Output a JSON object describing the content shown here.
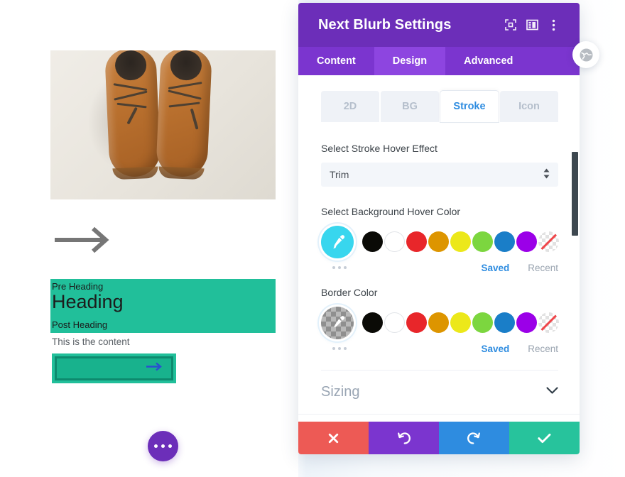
{
  "preview": {
    "photo_alt": "brown-leather-shoes-photo",
    "arrow_icon": "long-arrow-right-icon",
    "pre_heading": "Pre Heading",
    "heading": "Heading",
    "post_heading": "Post Heading",
    "content": "This is the content",
    "cta_arrow_icon": "arrow-right-icon",
    "band_color": "#21bf9a",
    "cta_border_color": "#0d8a6e",
    "cta_fill_color": "#18b28d",
    "cta_arrow_color": "#2a4fd0",
    "fab_icon": "ellipsis-icon",
    "fab_color": "#6c2eb9"
  },
  "panel": {
    "title": "Next Blurb Settings",
    "accent_color": "#6c2eb9",
    "header_icons": [
      {
        "name": "focus-target-icon"
      },
      {
        "name": "layout-panel-icon"
      },
      {
        "name": "more-vertical-icon"
      }
    ],
    "tabs": [
      {
        "label": "Content",
        "active": false
      },
      {
        "label": "Design",
        "active": true
      },
      {
        "label": "Advanced",
        "active": false
      }
    ],
    "segment": [
      {
        "label": "2D",
        "active": false
      },
      {
        "label": "BG",
        "active": false
      },
      {
        "label": "Stroke",
        "active": true
      },
      {
        "label": "Icon",
        "active": false
      }
    ],
    "stroke_effect": {
      "label": "Select Stroke Hover Effect",
      "value": "Trim",
      "caret_icon": "updown-caret-icon"
    },
    "color_fields": [
      {
        "label": "Select Background Hover Color",
        "eyedropper": {
          "name": "eyedropper-icon",
          "fill": "#38d6ee",
          "transparent": false
        },
        "swatches": [
          {
            "name": "swatch-black",
            "color": "#0a0a06"
          },
          {
            "name": "swatch-white",
            "color": "#ffffff"
          },
          {
            "name": "swatch-red",
            "color": "#e8262a"
          },
          {
            "name": "swatch-orange",
            "color": "#dd9500"
          },
          {
            "name": "swatch-yellow",
            "color": "#ece81a"
          },
          {
            "name": "swatch-green",
            "color": "#7cd63f"
          },
          {
            "name": "swatch-blue",
            "color": "#1a7ec8"
          },
          {
            "name": "swatch-purple",
            "color": "#9b00e8"
          },
          {
            "name": "swatch-none",
            "color": "transparent"
          }
        ],
        "more_icon": "ellipsis-icon",
        "links": [
          {
            "label": "Saved",
            "active": true
          },
          {
            "label": "Recent",
            "active": false
          }
        ]
      },
      {
        "label": "Border Color",
        "eyedropper": {
          "name": "eyedropper-icon",
          "fill": "transparent",
          "transparent": true
        },
        "swatches": [
          {
            "name": "swatch-black",
            "color": "#0a0a06"
          },
          {
            "name": "swatch-white",
            "color": "#ffffff"
          },
          {
            "name": "swatch-red",
            "color": "#e8262a"
          },
          {
            "name": "swatch-orange",
            "color": "#dd9500"
          },
          {
            "name": "swatch-yellow",
            "color": "#ece81a"
          },
          {
            "name": "swatch-green",
            "color": "#7cd63f"
          },
          {
            "name": "swatch-blue",
            "color": "#1a7ec8"
          },
          {
            "name": "swatch-purple",
            "color": "#9b00e8"
          },
          {
            "name": "swatch-none",
            "color": "transparent"
          }
        ],
        "more_icon": "ellipsis-icon",
        "links": [
          {
            "label": "Saved",
            "active": true
          },
          {
            "label": "Recent",
            "active": false
          }
        ]
      }
    ],
    "accordion": {
      "title": "Sizing",
      "caret_icon": "chevron-down-icon"
    },
    "footer_buttons": [
      {
        "name": "cancel-button",
        "icon": "close-x-icon",
        "color": "#ed5a55"
      },
      {
        "name": "undo-button",
        "icon": "undo-icon",
        "color": "#7b35cf"
      },
      {
        "name": "redo-button",
        "icon": "redo-icon",
        "color": "#2e8ce0"
      },
      {
        "name": "save-button",
        "icon": "check-icon",
        "color": "#27c39c"
      }
    ]
  },
  "close_button": {
    "icon": "globe-icon"
  }
}
